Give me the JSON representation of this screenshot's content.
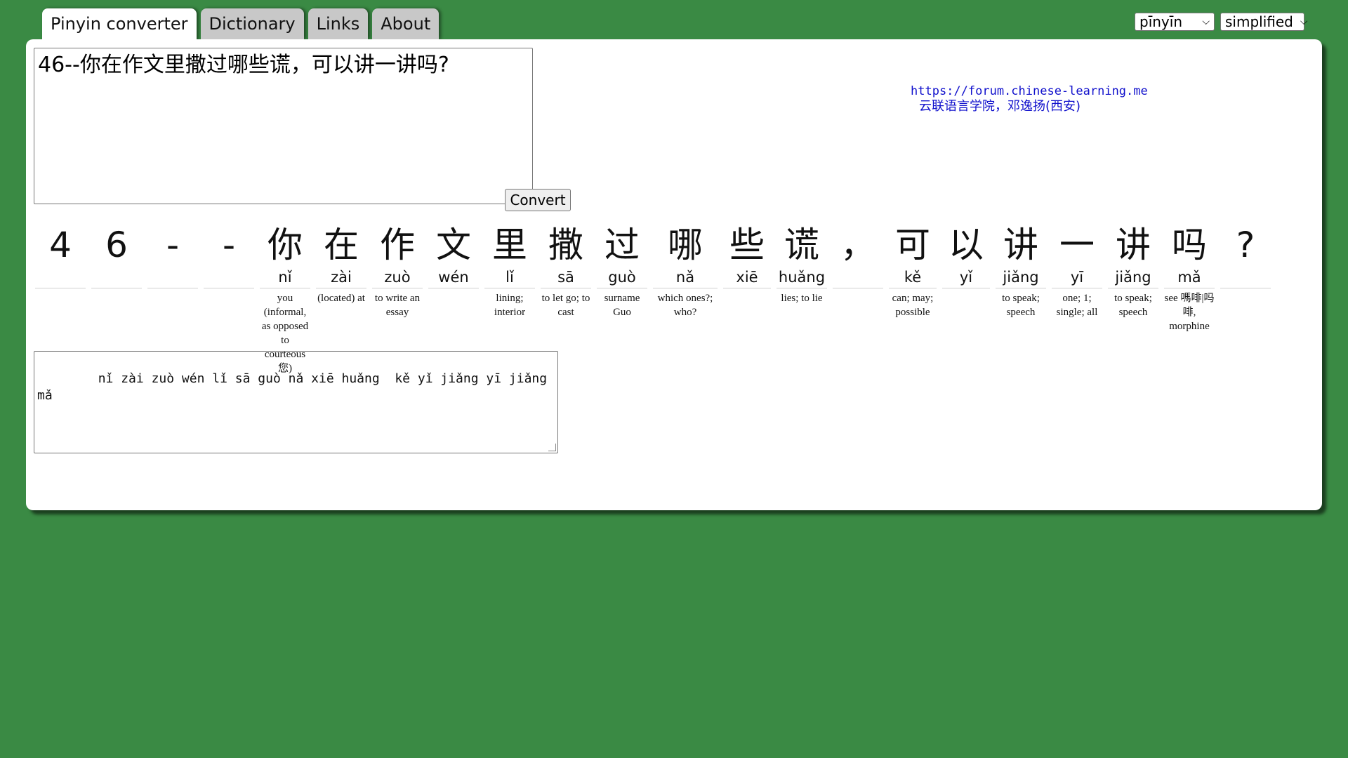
{
  "tabs": [
    {
      "label": "Pinyin converter",
      "active": true
    },
    {
      "label": "Dictionary",
      "active": false
    },
    {
      "label": "Links",
      "active": false
    },
    {
      "label": "About",
      "active": false
    }
  ],
  "selects": {
    "tone_mode": "pīnyīn",
    "script": "simplified"
  },
  "input_text": "46--你在作文里撒过哪些谎，可以讲一讲吗?",
  "convert_label": "Convert",
  "credit": {
    "url": "https://forum.chinese-learning.me",
    "org": "云联语言学院，邓逸扬(西安)"
  },
  "characters": [
    {
      "hz": "4",
      "py": "",
      "def": ""
    },
    {
      "hz": "6",
      "py": "",
      "def": ""
    },
    {
      "hz": "-",
      "py": "",
      "def": ""
    },
    {
      "hz": "-",
      "py": "",
      "def": ""
    },
    {
      "hz": "你",
      "py": "nǐ",
      "def": "you (informal, as opposed to courteous 您)"
    },
    {
      "hz": "在",
      "py": "zài",
      "def": "(located) at"
    },
    {
      "hz": "作",
      "py": "zuò",
      "def": "to write an essay"
    },
    {
      "hz": "文",
      "py": "wén",
      "def": ""
    },
    {
      "hz": "里",
      "py": "lǐ",
      "def": "lining; interior"
    },
    {
      "hz": "撒",
      "py": "sā",
      "def": "to let go; to cast"
    },
    {
      "hz": "过",
      "py": "guò",
      "def": "surname Guo"
    },
    {
      "hz": "哪",
      "py": "nǎ",
      "def": "which ones?; who?"
    },
    {
      "hz": "些",
      "py": "xiē",
      "def": ""
    },
    {
      "hz": "谎",
      "py": "huǎng",
      "def": "lies; to lie"
    },
    {
      "hz": "，",
      "py": "",
      "def": ""
    },
    {
      "hz": "可",
      "py": "kě",
      "def": "can; may; possible"
    },
    {
      "hz": "以",
      "py": "yǐ",
      "def": ""
    },
    {
      "hz": "讲",
      "py": "jiǎng",
      "def": "to speak; speech"
    },
    {
      "hz": "一",
      "py": "yī",
      "def": "one; 1; single; all"
    },
    {
      "hz": "讲",
      "py": "jiǎng",
      "def": "to speak; speech"
    },
    {
      "hz": "吗",
      "py": "mǎ",
      "def": "see 嗎啡|吗啡, morphine"
    },
    {
      "hz": "?",
      "py": "",
      "def": ""
    }
  ],
  "output_text": "    nǐ zài zuò wén lǐ sā guò nǎ xiē huǎng  kě yǐ jiǎng yī jiǎng mǎ"
}
